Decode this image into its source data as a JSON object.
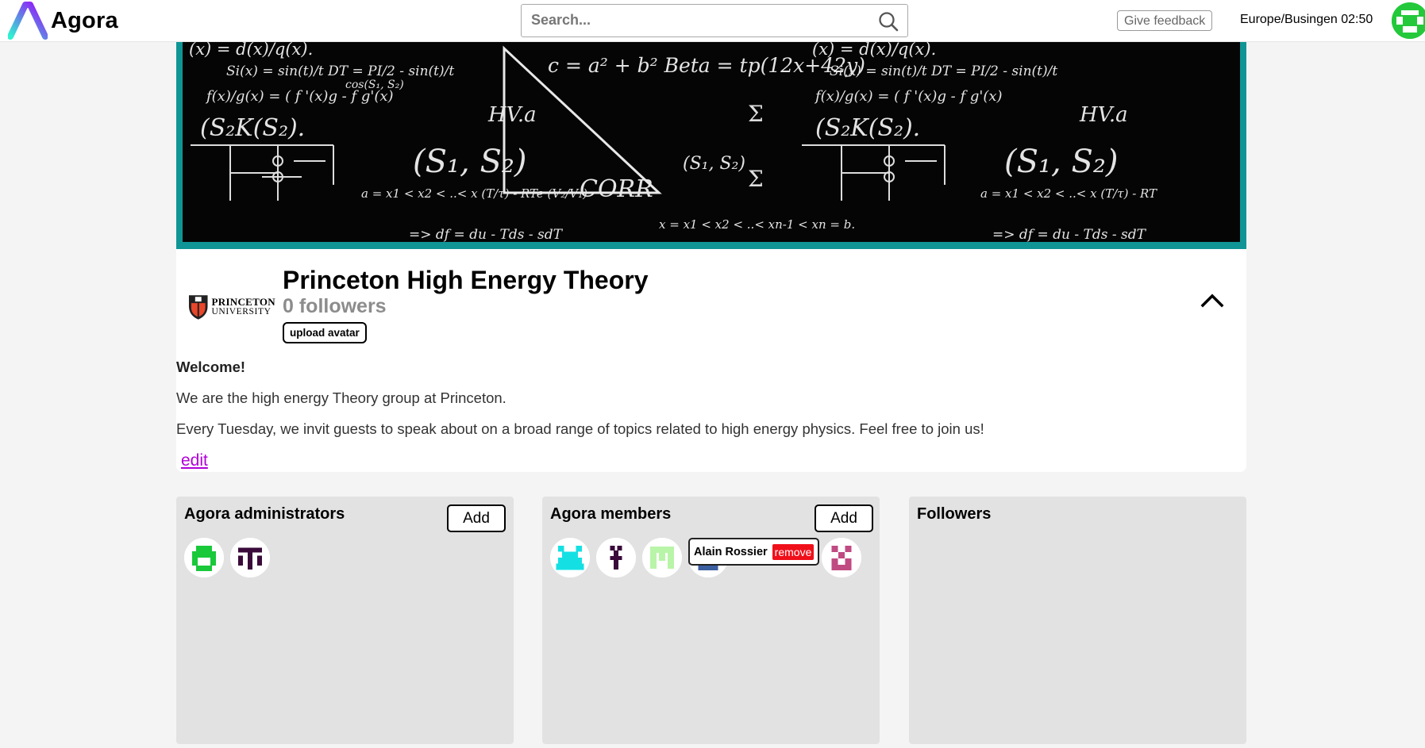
{
  "header": {
    "app_name": "Agora",
    "search_placeholder": "Search...",
    "feedback_label": "Give feedback",
    "timezone_clock": "Europe/Busingen 02:50",
    "logo_colors": [
      "#2ef2d0",
      "#a000ff"
    ],
    "user_avatar_color": "#23c93a"
  },
  "banner": {
    "frame_color": "#0f9595",
    "chalk_formulas": [
      "(x) = d(x)/q(x).",
      "Si(x) = sin(t)/t DT = PI/2 - sin(t)/t",
      "f(x)/g(x) = ( f '(x)g - f g'(x)",
      "(S₂K(S₂).",
      "(S₁, S₂)",
      "a = x1 < x2 < ..< x (T/τ) - RTe (V₂/V₁)",
      "=> df = du - Tds - sdT",
      "c = a² + b²  Beta = tp(12x+42y)",
      "cos(S₁, S₂)",
      "HV.a",
      "x = x1 < x2 < ..< xn-1 < xn = b.",
      "(S₁, S₂)",
      "CORR"
    ]
  },
  "channel": {
    "institution_line1": "PRINCETON",
    "institution_line2": "UNIVERSITY",
    "name": "Princeton High Energy Theory",
    "followers": "0 followers",
    "upload_avatar": "upload avatar",
    "description": {
      "welcome": "Welcome!",
      "line1": "We are the high energy Theory group at Princeton.",
      "line2": "Every Tuesday, we invit guests to speak about on a broad range of topics related to high energy physics. Feel free to join us!"
    },
    "edit_label": "edit"
  },
  "panels": {
    "admins": {
      "title": "Agora administrators",
      "add_label": "Add",
      "avatar_colors": [
        "#19c93a",
        "#3a0a3a"
      ]
    },
    "members": {
      "title": "Agora members",
      "add_label": "Add",
      "avatar_colors": [
        "#14e0e4",
        "#3a0a3a",
        "#b8f5a8",
        "#3b5fa0",
        "#c04a82"
      ],
      "hover_tooltip": {
        "name": "Alain Rossier",
        "remove_label": "remove"
      }
    },
    "followers": {
      "title": "Followers"
    }
  }
}
